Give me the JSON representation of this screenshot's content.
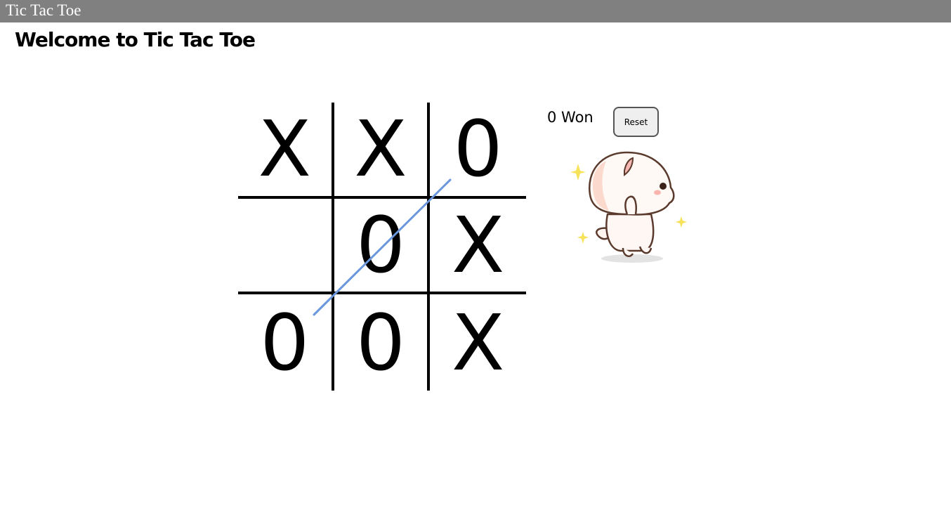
{
  "window": {
    "title": "Tic Tac Toe"
  },
  "page": {
    "heading": "Welcome to Tic Tac Toe"
  },
  "board": {
    "cells": [
      [
        "X",
        "X",
        "0"
      ],
      [
        "",
        "0",
        "X"
      ],
      [
        "0",
        "0",
        "X"
      ]
    ],
    "winning_line": {
      "from_cell": [
        2,
        0
      ],
      "to_cell": [
        0,
        2
      ],
      "color": "#6a96dc"
    }
  },
  "status": {
    "score_text": "0 Won"
  },
  "controls": {
    "reset_label": "Reset"
  },
  "mascot": {
    "icon": "cat-mascot-icon"
  }
}
